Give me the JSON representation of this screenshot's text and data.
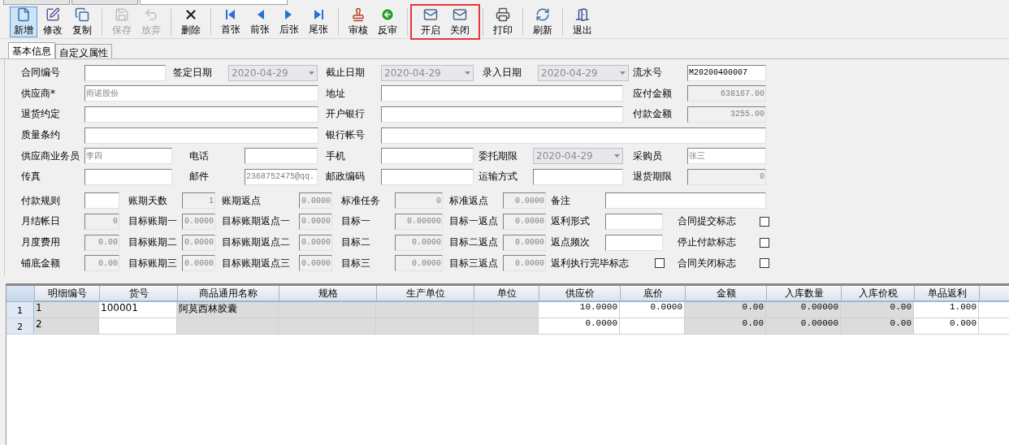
{
  "doc_tabs": [
    {
      "selected": false
    },
    {
      "selected": false
    },
    {
      "selected": true
    }
  ],
  "toolbar": {
    "groups": [
      {
        "highlighted": false,
        "buttons": [
          {
            "label": "新增",
            "selected": true,
            "disabled": false
          },
          {
            "label": "修改",
            "selected": false,
            "disabled": false
          },
          {
            "label": "复制",
            "selected": false,
            "disabled": false
          }
        ]
      },
      {
        "highlighted": false,
        "buttons": [
          {
            "label": "保存",
            "selected": false,
            "disabled": true
          },
          {
            "label": "放弃",
            "selected": false,
            "disabled": true
          }
        ]
      },
      {
        "highlighted": false,
        "buttons": [
          {
            "label": "删除",
            "selected": false,
            "disabled": false
          }
        ]
      },
      {
        "highlighted": false,
        "buttons": [
          {
            "label": "首张",
            "selected": false,
            "disabled": false
          },
          {
            "label": "前张",
            "selected": false,
            "disabled": false
          },
          {
            "label": "后张",
            "selected": false,
            "disabled": false
          },
          {
            "label": "尾张",
            "selected": false,
            "disabled": false
          }
        ]
      },
      {
        "highlighted": false,
        "buttons": [
          {
            "label": "审核",
            "selected": false,
            "disabled": false
          },
          {
            "label": "反审",
            "selected": false,
            "disabled": false
          }
        ]
      },
      {
        "highlighted": true,
        "buttons": [
          {
            "label": "开启",
            "selected": false,
            "disabled": false
          },
          {
            "label": "关闭",
            "selected": false,
            "disabled": false
          }
        ]
      },
      {
        "highlighted": false,
        "buttons": [
          {
            "label": "打印",
            "selected": false,
            "disabled": false
          }
        ]
      },
      {
        "highlighted": false,
        "buttons": [
          {
            "label": "刷新",
            "selected": false,
            "disabled": false
          }
        ]
      },
      {
        "highlighted": false,
        "buttons": [
          {
            "label": "退出",
            "selected": false,
            "disabled": false
          }
        ]
      }
    ]
  },
  "tabs": [
    {
      "label": "基本信息",
      "selected": true
    },
    {
      "label": "自定义属性",
      "selected": false
    }
  ],
  "form_rows": [
    [
      {
        "label": "合同编号",
        "kind": "text"
      },
      {
        "label": "签定日期",
        "kind": "date",
        "value": "2020-04-29"
      },
      {
        "label": "截止日期",
        "kind": "date",
        "value": "2020-04-29"
      },
      {
        "label": "录入日期",
        "kind": "date",
        "value": "2020-04-29"
      },
      {
        "label": "流水号",
        "kind": "text",
        "value": "M20200400007"
      }
    ],
    [
      {
        "label": "供应商*",
        "kind": "text",
        "value": "雨诺股份",
        "disabled": true
      },
      {
        "label": "地址",
        "kind": "text"
      },
      {
        "label": "应付金额",
        "kind": "readonly",
        "value": "638167.00"
      }
    ],
    [
      {
        "label": "退货约定",
        "kind": "text"
      },
      {
        "label": "开户银行",
        "kind": "text"
      },
      {
        "label": "付款金额",
        "kind": "readonly",
        "value": "3255.00"
      }
    ],
    [
      {
        "label": "质量条约",
        "kind": "text"
      },
      {
        "label": "银行帐号",
        "kind": "text"
      }
    ],
    [
      {
        "label": "供应商业务员",
        "kind": "text",
        "value": "李四",
        "disabled": true
      },
      {
        "label": "电话",
        "kind": "text"
      },
      {
        "label": "手机",
        "kind": "text"
      },
      {
        "label": "委托期限",
        "kind": "date",
        "value": "2020-04-29"
      },
      {
        "label": "采购员",
        "kind": "text",
        "value": "张三",
        "disabled": true
      }
    ],
    [
      {
        "label": "传真",
        "kind": "text"
      },
      {
        "label": "邮件",
        "kind": "text",
        "value": "2368752475@qq.",
        "disabled": true
      },
      {
        "label": "邮政编码",
        "kind": "text"
      },
      {
        "label": "运输方式",
        "kind": "text"
      },
      {
        "label": "退货期限",
        "kind": "readonly",
        "value": "0"
      }
    ],
    [
      {
        "label": "付款规则",
        "kind": "text"
      },
      {
        "label": "账期天数",
        "kind": "readonly",
        "value": "1"
      },
      {
        "label": "账期返点",
        "kind": "readonly",
        "value": "0.0000"
      },
      {
        "label": "标准任务",
        "kind": "readonly",
        "value": "0"
      },
      {
        "label": "标准返点",
        "kind": "readonly",
        "value": "0.0000"
      },
      {
        "label": "备注",
        "kind": "text"
      }
    ],
    [
      {
        "label": "月结帐日",
        "kind": "readonly",
        "value": "0"
      },
      {
        "label": "目标账期一",
        "kind": "readonly",
        "value": "0.0000"
      },
      {
        "label": "目标账期返点一",
        "kind": "readonly",
        "value": "0.0000"
      },
      {
        "label": "目标一",
        "kind": "readonly",
        "value": "0.00000"
      },
      {
        "label": "目标一返点",
        "kind": "readonly",
        "value": "0.0000"
      },
      {
        "label": "返利形式",
        "kind": "text"
      },
      {
        "label": "合同提交标志",
        "kind": "checkbox",
        "checked": false
      }
    ],
    [
      {
        "label": "月度费用",
        "kind": "readonly",
        "value": "0.00"
      },
      {
        "label": "目标账期二",
        "kind": "readonly",
        "value": "0.0000"
      },
      {
        "label": "目标账期返点二",
        "kind": "readonly",
        "value": "0.0000"
      },
      {
        "label": "目标二",
        "kind": "readonly",
        "value": "0.0000"
      },
      {
        "label": "目标二返点",
        "kind": "readonly",
        "value": "0.0000"
      },
      {
        "label": "返点频次",
        "kind": "text"
      },
      {
        "label": "停止付款标志",
        "kind": "checkbox",
        "checked": false
      }
    ],
    [
      {
        "label": "铺底金额",
        "kind": "readonly",
        "value": "0.00"
      },
      {
        "label": "目标账期三",
        "kind": "readonly",
        "value": "0.0000"
      },
      {
        "label": "目标账期返点三",
        "kind": "readonly",
        "value": "0.0000"
      },
      {
        "label": "目标三",
        "kind": "readonly",
        "value": "0.0000"
      },
      {
        "label": "目标三返点",
        "kind": "readonly",
        "value": "0.0000"
      },
      {
        "label": "返利执行完毕标志",
        "kind": "checkbox",
        "checked": false
      },
      {
        "label": "合同关闭标志",
        "kind": "checkbox",
        "checked": false
      }
    ]
  ],
  "grid": {
    "columns": [
      {
        "label": "明细编号",
        "kind": "text",
        "editable": false
      },
      {
        "label": "货号",
        "kind": "text",
        "editable": true
      },
      {
        "label": "商品通用名称",
        "kind": "text",
        "editable": false
      },
      {
        "label": "规格",
        "kind": "text",
        "editable": false
      },
      {
        "label": "生产单位",
        "kind": "text",
        "editable": false
      },
      {
        "label": "单位",
        "kind": "text",
        "editable": false
      },
      {
        "label": "供应价",
        "kind": "number",
        "editable": true
      },
      {
        "label": "底价",
        "kind": "number",
        "editable": true
      },
      {
        "label": "金额",
        "kind": "number",
        "editable": false
      },
      {
        "label": "入库数量",
        "kind": "number",
        "editable": false
      },
      {
        "label": "入库价税",
        "kind": "number",
        "editable": false
      },
      {
        "label": "单品返利",
        "kind": "number",
        "editable": true
      },
      {
        "kind": "text",
        "editable": true
      }
    ],
    "rows": [
      {
        "number": "1",
        "cells": [
          "1",
          "100001",
          "阿莫西林胶囊",
          null,
          null,
          null,
          "10.0000",
          "0.0000",
          "0.00",
          "0.00000",
          "0.00",
          "1.000",
          null
        ]
      },
      {
        "number": "2",
        "cells": [
          "2",
          null,
          null,
          null,
          null,
          null,
          "0.0000",
          null,
          "0.00",
          "0.00000",
          "0.00",
          "0.000",
          null
        ]
      }
    ]
  }
}
